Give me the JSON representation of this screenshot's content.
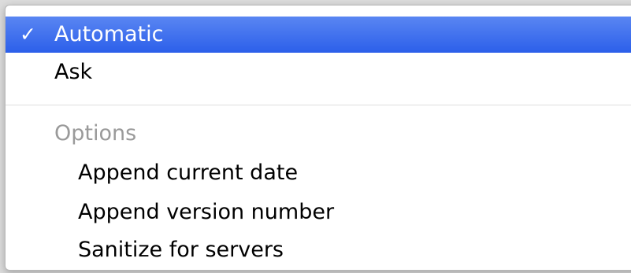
{
  "menu": {
    "items": [
      {
        "label": "Automatic",
        "checked": true,
        "selected": true,
        "check_glyph": "✓"
      },
      {
        "label": "Ask",
        "checked": false,
        "selected": false
      }
    ],
    "options_header": "Options",
    "options": [
      {
        "label": "Append current date"
      },
      {
        "label": "Append version number"
      },
      {
        "label": "Sanitize for servers"
      }
    ],
    "colors": {
      "selection_top": "#5a86f2",
      "selection_bottom": "#2c5fea",
      "header_text": "#9a9a9a",
      "separator": "#dedede"
    }
  }
}
